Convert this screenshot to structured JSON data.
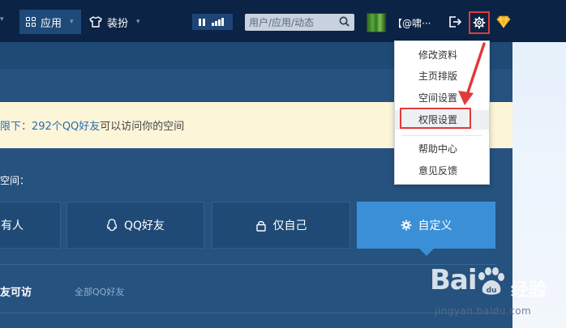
{
  "nav": {
    "apps_label": "应用",
    "outfit_label": "装扮",
    "search_placeholder": "用户/应用/动态",
    "username": "【@啸···"
  },
  "dropdown": {
    "items": [
      "修改资料",
      "主页排版",
      "空间设置",
      "权限设置",
      "帮助中心",
      "意见反馈"
    ],
    "active_index": 3
  },
  "notice": {
    "prefix": "限下：",
    "link_text": "292个QQ好友",
    "suffix": "可以访问你的空间"
  },
  "section_label": "空间：",
  "options": {
    "all": "有人",
    "qq_friends": "QQ好友",
    "self_only": "仅自己",
    "custom": "自定义"
  },
  "friends": {
    "label": "友可访",
    "sub": "全部QQ好友"
  },
  "watermark": {
    "logo": "Bai",
    "cn": "经验",
    "url": "jingyan.baidu.com"
  },
  "colors": {
    "topbar": "#0b2345",
    "panel": "#26527f",
    "accent": "#3b8fd6",
    "annotation_red": "#e23a3a"
  },
  "icons": [
    "chevron-down-icon",
    "apps-grid-icon",
    "tshirt-icon",
    "pause-icon",
    "bars-icon",
    "search-icon",
    "logout-icon",
    "gear-icon",
    "diamond-icon",
    "qq-penguin-icon",
    "lock-icon",
    "gear-small-icon"
  ]
}
